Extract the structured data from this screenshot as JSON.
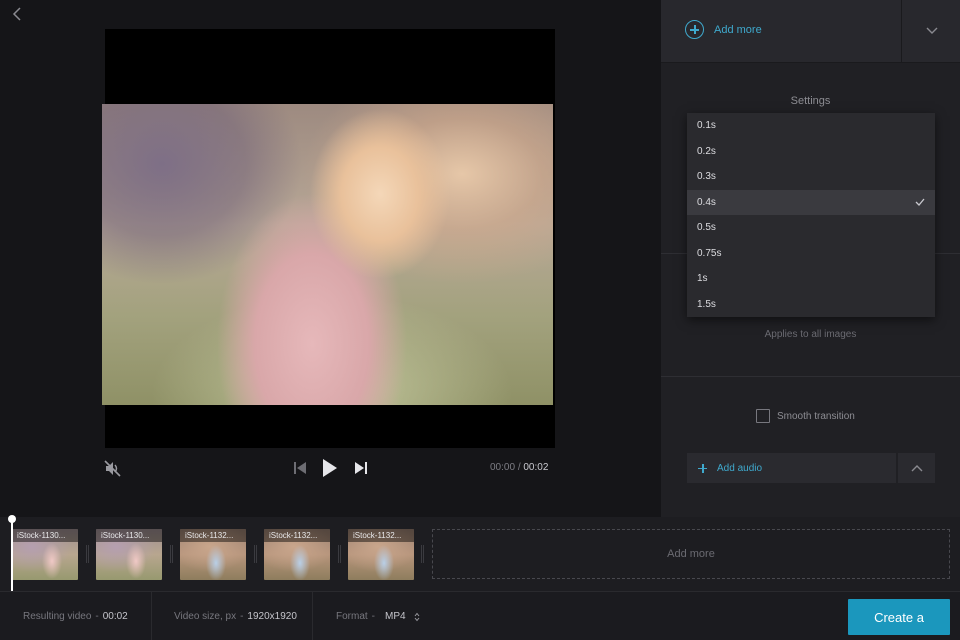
{
  "colors": {
    "accent": "#3fa9cd",
    "create_button": "#1b97bd",
    "background": "#151518",
    "panel": "#202024"
  },
  "header": {
    "back_icon": "chevron-left-icon"
  },
  "player": {
    "time_current": "00:00",
    "time_separator": "/",
    "time_total": "00:02",
    "icons": [
      "mute-icon",
      "skip-previous-icon",
      "play-icon",
      "skip-next-icon"
    ]
  },
  "panel": {
    "add_more_label": "Add more",
    "settings_title": "Settings",
    "applies_note": "Applies to all images",
    "smooth_transition_label": "Smooth transition",
    "add_audio_label": "Add audio"
  },
  "dropdown": {
    "options": [
      "0.1s",
      "0.2s",
      "0.3s",
      "0.4s",
      "0.5s",
      "0.75s",
      "1s",
      "1.5s"
    ],
    "selected": "0.4s"
  },
  "timeline": {
    "thumbnails": [
      {
        "label": "iStock-1130..."
      },
      {
        "label": "iStock-1130..."
      },
      {
        "label": "iStock-1132..."
      },
      {
        "label": "iStock-1132..."
      },
      {
        "label": "iStock-1132..."
      }
    ],
    "add_more_label": "Add more"
  },
  "footer": {
    "resulting_video_label": "Resulting video",
    "resulting_video_value": "00:02",
    "video_size_label": "Video size, px",
    "video_size_value": "1920x1920",
    "format_label": "Format",
    "format_value": "MP4",
    "dash": "-",
    "create_label": "Create a"
  }
}
